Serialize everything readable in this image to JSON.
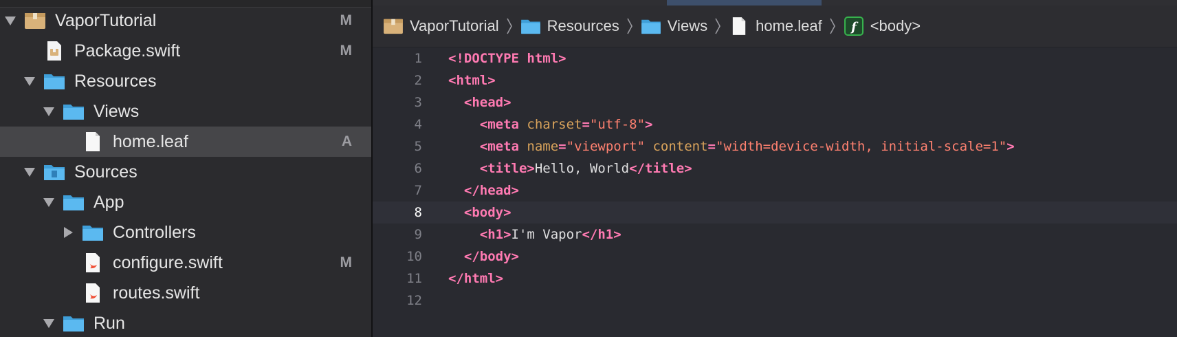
{
  "navigator": {
    "items": [
      {
        "label": "VaporTutorial",
        "badge": "M",
        "icon": "project-package-icon",
        "expanded": true
      },
      {
        "label": "Package.swift",
        "badge": "M",
        "icon": "package-swift-icon"
      },
      {
        "label": "Resources",
        "badge": "",
        "icon": "folder-icon",
        "expanded": true
      },
      {
        "label": "Views",
        "badge": "",
        "icon": "folder-icon",
        "expanded": true
      },
      {
        "label": "home.leaf",
        "badge": "A",
        "icon": "file-icon",
        "selected": true
      },
      {
        "label": "Sources",
        "badge": "",
        "icon": "sources-folder-icon",
        "expanded": true
      },
      {
        "label": "App",
        "badge": "",
        "icon": "folder-icon",
        "expanded": true
      },
      {
        "label": "Controllers",
        "badge": "",
        "icon": "folder-icon",
        "expanded": false
      },
      {
        "label": "configure.swift",
        "badge": "M",
        "icon": "swift-file-icon"
      },
      {
        "label": "routes.swift",
        "badge": "",
        "icon": "swift-file-icon"
      },
      {
        "label": "Run",
        "badge": "",
        "icon": "folder-icon",
        "expanded": true
      }
    ]
  },
  "jumpbar": {
    "crumbs": [
      {
        "label": "VaporTutorial",
        "icon": "project-package-icon"
      },
      {
        "label": "Resources",
        "icon": "folder-icon"
      },
      {
        "label": "Views",
        "icon": "folder-icon"
      },
      {
        "label": "home.leaf",
        "icon": "file-icon"
      },
      {
        "label": "<body>",
        "icon": "function-icon"
      }
    ]
  },
  "editor": {
    "current_line": 8,
    "lines": [
      {
        "n": "1",
        "parts": [
          [
            "tag",
            "<!DOCTYPE html>"
          ]
        ]
      },
      {
        "n": "2",
        "parts": [
          [
            "tag",
            "<html>"
          ]
        ]
      },
      {
        "n": "3",
        "parts": [
          [
            "txt",
            "  "
          ],
          [
            "tag",
            "<head>"
          ]
        ]
      },
      {
        "n": "4",
        "parts": [
          [
            "txt",
            "    "
          ],
          [
            "tag",
            "<meta "
          ],
          [
            "attr",
            "charset"
          ],
          [
            "tag",
            "="
          ],
          [
            "str",
            "\"utf-8\""
          ],
          [
            "tag",
            ">"
          ]
        ]
      },
      {
        "n": "5",
        "parts": [
          [
            "txt",
            "    "
          ],
          [
            "tag",
            "<meta "
          ],
          [
            "attr",
            "name"
          ],
          [
            "tag",
            "="
          ],
          [
            "str",
            "\"viewport\""
          ],
          [
            "txt",
            " "
          ],
          [
            "attr",
            "content"
          ],
          [
            "tag",
            "="
          ],
          [
            "str",
            "\"width=device-width, initial-scale=1\""
          ],
          [
            "tag",
            ">"
          ]
        ]
      },
      {
        "n": "6",
        "parts": [
          [
            "txt",
            "    "
          ],
          [
            "tag",
            "<title>"
          ],
          [
            "txt",
            "Hello, World"
          ],
          [
            "tag",
            "</title>"
          ]
        ]
      },
      {
        "n": "7",
        "parts": [
          [
            "txt",
            "  "
          ],
          [
            "tag",
            "</head>"
          ]
        ]
      },
      {
        "n": "8",
        "parts": [
          [
            "txt",
            "  "
          ],
          [
            "tag",
            "<body>"
          ]
        ]
      },
      {
        "n": "9",
        "parts": [
          [
            "txt",
            "    "
          ],
          [
            "tag",
            "<h1>"
          ],
          [
            "txt",
            "I'm Vapor"
          ],
          [
            "tag",
            "</h1>"
          ]
        ]
      },
      {
        "n": "10",
        "parts": [
          [
            "txt",
            "  "
          ],
          [
            "tag",
            "</body>"
          ]
        ]
      },
      {
        "n": "11",
        "parts": [
          [
            "tag",
            "</html>"
          ]
        ]
      },
      {
        "n": "12",
        "parts": []
      }
    ]
  },
  "colors": {
    "tag": "#ff7ab2",
    "attribute": "#d9a35b",
    "string": "#ff8170",
    "folder": "#5bb9f0",
    "package": "#d9b27a",
    "swift": "#f05138",
    "selection": "#464649"
  }
}
